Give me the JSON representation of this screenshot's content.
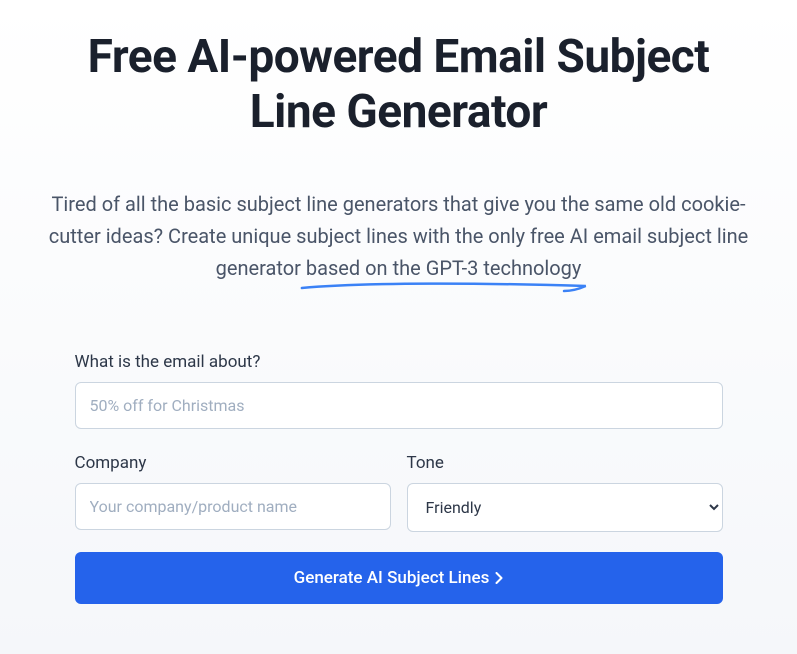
{
  "header": {
    "title": "Free AI-powered Email Subject Line Generator",
    "subtitle_prefix": "Tired of all the basic subject line generators that give you the same old cookie-cutter ideas? Create unique subject lines with the only free AI email subject line generator ",
    "subtitle_underlined": "based on the GPT-3 technology"
  },
  "form": {
    "about": {
      "label": "What is the email about?",
      "placeholder": "50% off for Christmas"
    },
    "company": {
      "label": "Company",
      "placeholder": "Your company/product name"
    },
    "tone": {
      "label": "Tone",
      "selected": "Friendly"
    },
    "submit_label": "Generate AI Subject Lines"
  },
  "colors": {
    "accent": "#2563eb",
    "underline": "#3b82f6"
  }
}
